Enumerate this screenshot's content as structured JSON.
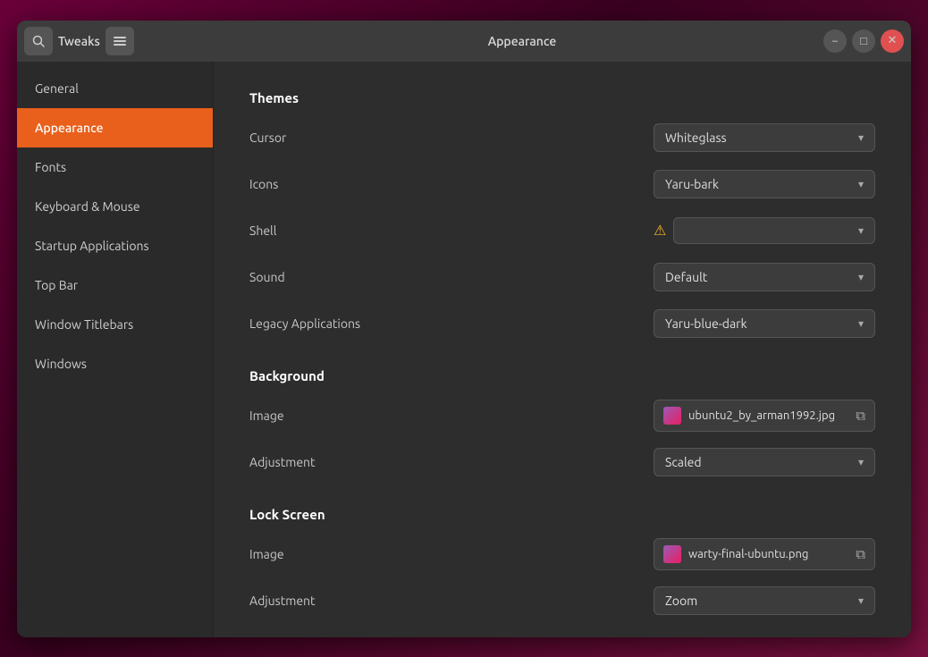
{
  "titlebar": {
    "app_name": "Tweaks",
    "page_title": "Appearance",
    "minimize_label": "−",
    "maximize_label": "□",
    "close_label": "✕"
  },
  "sidebar": {
    "items": [
      {
        "id": "general",
        "label": "General",
        "active": false
      },
      {
        "id": "appearance",
        "label": "Appearance",
        "active": true
      },
      {
        "id": "fonts",
        "label": "Fonts",
        "active": false
      },
      {
        "id": "keyboard-mouse",
        "label": "Keyboard & Mouse",
        "active": false
      },
      {
        "id": "startup-applications",
        "label": "Startup Applications",
        "active": false
      },
      {
        "id": "top-bar",
        "label": "Top Bar",
        "active": false
      },
      {
        "id": "window-titlebars",
        "label": "Window Titlebars",
        "active": false
      },
      {
        "id": "windows",
        "label": "Windows",
        "active": false
      }
    ]
  },
  "main": {
    "themes_section": "Themes",
    "cursor_label": "Cursor",
    "cursor_value": "Whiteglass",
    "icons_label": "Icons",
    "icons_value": "Yaru-bark",
    "shell_label": "Shell",
    "shell_value": "",
    "sound_label": "Sound",
    "sound_value": "Default",
    "legacy_applications_label": "Legacy Applications",
    "legacy_applications_value": "Yaru-blue-dark",
    "background_section": "Background",
    "bg_image_label": "Image",
    "bg_image_value": "ubuntu2_by_arman1992.jpg",
    "bg_adjustment_label": "Adjustment",
    "bg_adjustment_value": "Scaled",
    "lock_screen_section": "Lock Screen",
    "ls_image_label": "Image",
    "ls_image_value": "warty-final-ubuntu.png",
    "ls_adjustment_label": "Adjustment",
    "ls_adjustment_value": "Zoom"
  }
}
